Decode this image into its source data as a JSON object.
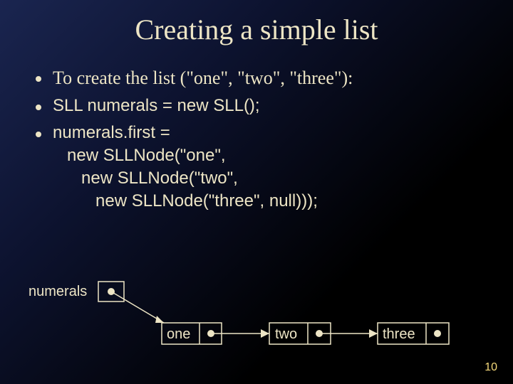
{
  "title": "Creating a simple list",
  "bullets": {
    "b1": "To create the list (\"one\", \"two\", \"three\"):",
    "b2": "SLL numerals = new SLL();",
    "b3_l1": "numerals.first =",
    "b3_l2": "   new SLLNode(\"one\",",
    "b3_l3": "      new SLLNode(\"two\",",
    "b3_l4": "         new SLLNode(\"three\", null)));"
  },
  "diagram": {
    "head": "numerals",
    "n1": "one",
    "n2": "two",
    "n3": "three"
  },
  "page": "10"
}
